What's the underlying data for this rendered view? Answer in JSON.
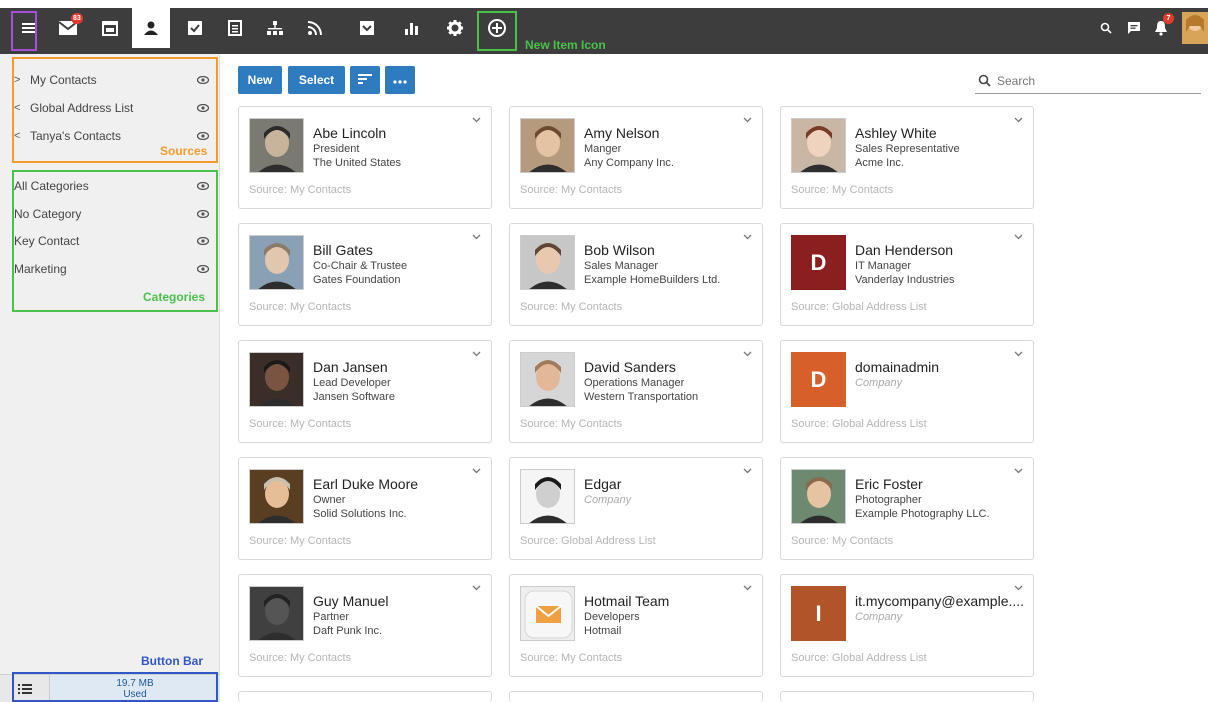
{
  "topbar": {
    "mail_badge": "83",
    "notif_badge": "7",
    "icons": [
      "hamburger-icon",
      "mail-icon",
      "calendar-icon",
      "contacts-icon",
      "tasks-icon",
      "notes-icon",
      "org-chart-icon",
      "rss-icon",
      "archive-icon",
      "stats-icon",
      "gear-icon",
      "plus-circle-icon"
    ],
    "right_icons": [
      "search-icon",
      "chat-icon",
      "bell-icon",
      "avatar"
    ]
  },
  "annotations": {
    "new_item": "New Item Icon",
    "sources": "Sources",
    "categories": "Categories",
    "button_bar": "Button Bar"
  },
  "sidebar": {
    "sources": [
      {
        "label": "My Contacts",
        "arrow": ">"
      },
      {
        "label": "Global Address List",
        "arrow": "<"
      },
      {
        "label": "Tanya's Contacts",
        "arrow": "<"
      }
    ],
    "categories": [
      {
        "label": "All Categories"
      },
      {
        "label": "No Category"
      },
      {
        "label": "Key Contact"
      },
      {
        "label": "Marketing"
      }
    ],
    "usage_value": "19.7 MB",
    "usage_label": "Used"
  },
  "toolbar": {
    "new_label": "New",
    "select_label": "Select",
    "search_placeholder": "Search"
  },
  "contacts": [
    {
      "name": "Abe Lincoln",
      "title": "President",
      "company": "The United States",
      "source": "Source: My Contacts"
    },
    {
      "name": "Amy Nelson",
      "title": "Manger",
      "company": "Any Company Inc.",
      "source": "Source: My Contacts"
    },
    {
      "name": "Ashley White",
      "title": "Sales Representative",
      "company": "Acme Inc.",
      "source": "Source: My Contacts"
    },
    {
      "name": "Bill Gates",
      "title": "Co-Chair & Trustee",
      "company": "Gates Foundation",
      "source": "Source: My Contacts"
    },
    {
      "name": "Bob Wilson",
      "title": "Sales Manager",
      "company": "Example HomeBuilders Ltd.",
      "source": "Source: My Contacts"
    },
    {
      "name": "Dan Henderson",
      "title": "IT Manager",
      "company": "Vanderlay Industries",
      "source": "Source: Global Address List",
      "initial": "D",
      "color": "#8b1f1f"
    },
    {
      "name": "Dan Jansen",
      "title": "Lead Developer",
      "company": "Jansen Software",
      "source": "Source: My Contacts"
    },
    {
      "name": "David Sanders",
      "title": "Operations Manager",
      "company": "Western Transportation",
      "source": "Source: My Contacts"
    },
    {
      "name": "domainadmin",
      "title": "",
      "company": "Company",
      "source": "Source: Global Address List",
      "initial": "D",
      "color": "#d7602a",
      "company_placeholder": true
    },
    {
      "name": "Earl Duke Moore",
      "title": "Owner",
      "company": "Solid Solutions Inc.",
      "source": "Source: My Contacts"
    },
    {
      "name": "Edgar",
      "title": "",
      "company": "Company",
      "source": "Source: Global Address List",
      "company_placeholder": true
    },
    {
      "name": "Eric Foster",
      "title": "Photographer",
      "company": "Example Photography LLC.",
      "source": "Source: My Contacts"
    },
    {
      "name": "Guy Manuel",
      "title": "Partner",
      "company": "Daft Punk Inc.",
      "source": "Source: My Contacts"
    },
    {
      "name": "Hotmail Team",
      "title": "Developers",
      "company": "Hotmail",
      "source": "Source: My Contacts"
    },
    {
      "name": "it.mycompany@example....",
      "title": "",
      "company": "Company",
      "source": "Source: Global Address List",
      "initial": "I",
      "color": "#b0552a",
      "company_placeholder": true
    }
  ],
  "colors": {
    "accent": "#2f7bbf",
    "topbar": "#3d3d3d",
    "sources_box": "#f39c2b",
    "categories_box": "#4ac14a",
    "hamburger_box": "#a64ed4",
    "buttonbar_box": "#3156c8",
    "newitem_box": "#4ac14a"
  }
}
